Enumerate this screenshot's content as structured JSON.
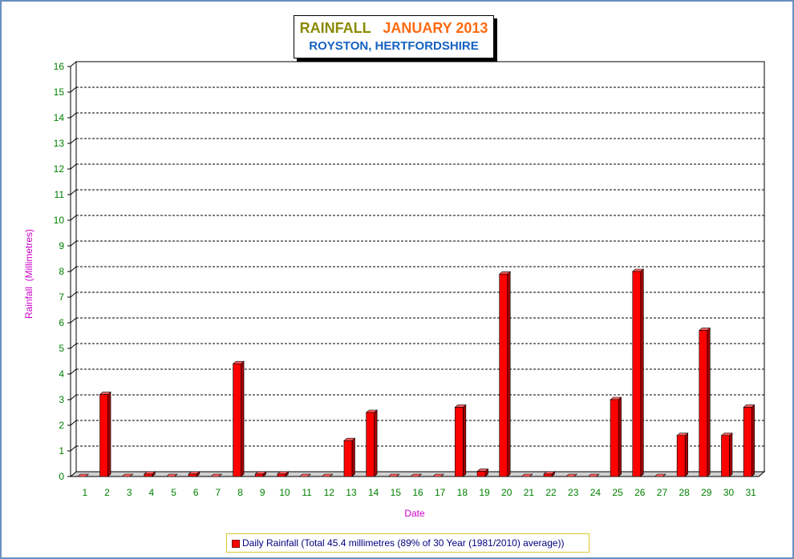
{
  "title": {
    "word": "RAINFALL",
    "month": "JANUARY 2013",
    "subtitle": "ROYSTON, HERTFORDSHIRE"
  },
  "colors": {
    "bar": "#ff0000",
    "bar_side": "#a00000",
    "bar_top": "#ff6060",
    "axis_ticks": "#008000",
    "axis_titles": "#cc00cc",
    "title_word": "#8a8a00",
    "title_month": "#ff6a10",
    "subtitle": "#1560c0"
  },
  "legend": {
    "label": "Daily Rainfall (Total 45.4 millimetres (89% of 30 Year (1981/2010) average))"
  },
  "chart_data": {
    "type": "bar",
    "title": "RAINFALL JANUARY 2013",
    "subtitle": "ROYSTON, HERTFORDSHIRE",
    "xlabel": "Date",
    "ylabel": "Rainfall  (Millimetres)",
    "ylim": [
      0,
      16
    ],
    "yticks": [
      0,
      1,
      2,
      3,
      4,
      5,
      6,
      7,
      8,
      9,
      10,
      11,
      12,
      13,
      14,
      15,
      16
    ],
    "grid": true,
    "legend_position": "bottom",
    "categories": [
      "1",
      "2",
      "3",
      "4",
      "5",
      "6",
      "7",
      "8",
      "9",
      "10",
      "11",
      "12",
      "13",
      "14",
      "15",
      "16",
      "17",
      "18",
      "19",
      "20",
      "21",
      "22",
      "23",
      "24",
      "25",
      "26",
      "27",
      "28",
      "29",
      "30",
      "31"
    ],
    "series": [
      {
        "name": "Daily Rainfall (Total 45.4 millimetres (89% of 30 Year (1981/2010) average))",
        "values": [
          0,
          3.2,
          0,
          0.1,
          0,
          0.1,
          0,
          4.4,
          0.1,
          0.1,
          0,
          0,
          1.4,
          2.5,
          0,
          0,
          0,
          2.7,
          0.2,
          7.9,
          0,
          0.1,
          0,
          0,
          3.0,
          8.0,
          0,
          1.6,
          5.7,
          1.6,
          2.7
        ]
      }
    ]
  }
}
